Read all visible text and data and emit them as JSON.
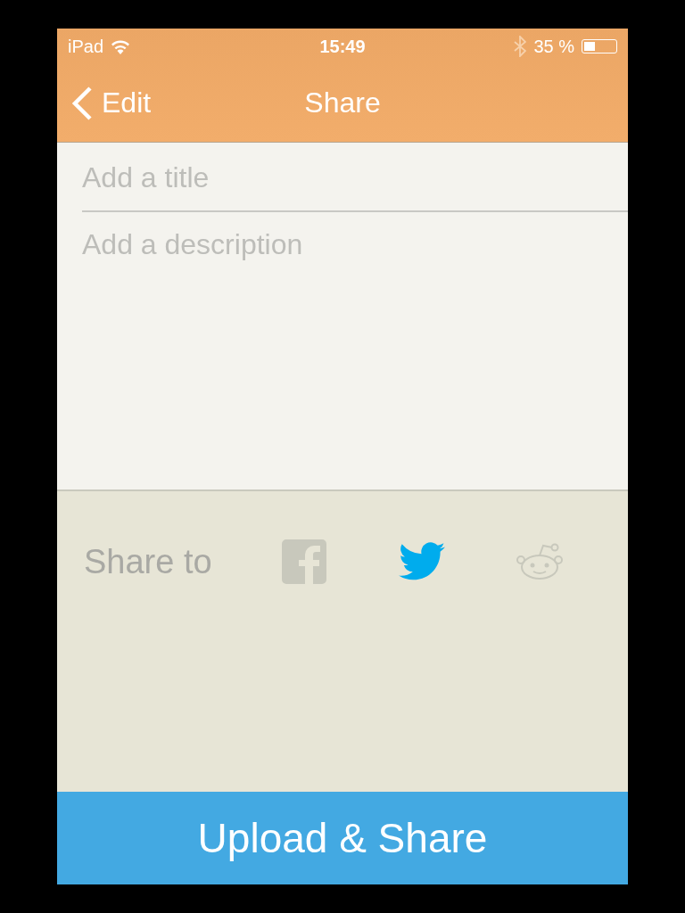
{
  "status_bar": {
    "device": "iPad",
    "time": "15:49",
    "battery": {
      "text": "35 %",
      "level": 0.35
    }
  },
  "nav_bar": {
    "back": "Edit",
    "title": "Share"
  },
  "form": {
    "title_placeholder": "Add a title",
    "description_placeholder": "Add a description"
  },
  "share": {
    "label": "Share to",
    "services": [
      {
        "kind": "facebook",
        "selected": false
      },
      {
        "kind": "twitter",
        "selected": true
      },
      {
        "kind": "reddit",
        "selected": false
      }
    ]
  },
  "upload_button": "Upload & Share"
}
